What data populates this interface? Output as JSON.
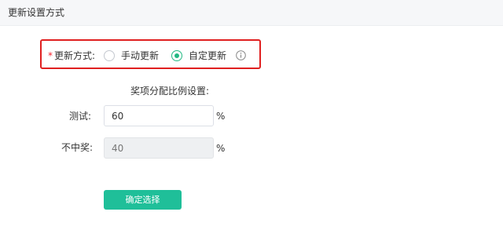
{
  "header": {
    "title": "更新设置方式"
  },
  "update_mode": {
    "required_mark": "*",
    "label": "更新方式:",
    "options": [
      {
        "label": "手动更新",
        "selected": false
      },
      {
        "label": "自定更新",
        "selected": true
      }
    ],
    "info_icon": "info-circle-icon"
  },
  "ratio_section": {
    "title": "奖项分配比例设置:",
    "fields": [
      {
        "label": "测试:",
        "value": "60",
        "unit": "%",
        "disabled": false
      },
      {
        "label": "不中奖:",
        "value": "40",
        "unit": "%",
        "disabled": true
      }
    ]
  },
  "actions": {
    "confirm_label": "确定选择"
  },
  "colors": {
    "accent": "#1fbf99",
    "highlight_border": "#e02020",
    "required": "#f5222d"
  }
}
